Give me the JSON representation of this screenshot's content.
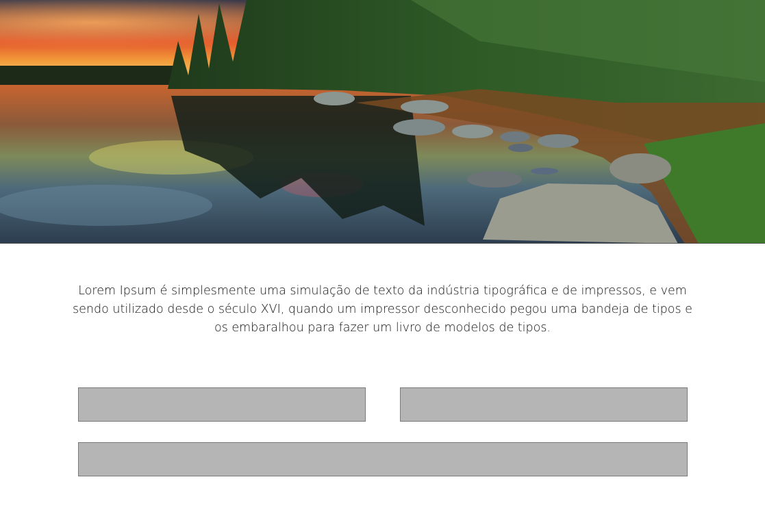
{
  "hero": {
    "image": "lake-forest-sunset-landscape"
  },
  "intro": {
    "text": "Lorem Ipsum é simplesmente uma simulação de texto da indústria tipográfica e de impressos, e vem sendo utilizado desde o século XVI, quando um impressor desconhecido pegou uma bandeja de tipos e os embaralhou para fazer um livro de modelos de tipos."
  },
  "fields": [
    {
      "value": ""
    },
    {
      "value": ""
    },
    {
      "value": ""
    }
  ],
  "colors": {
    "field_fill": "#b5b5b5",
    "field_border": "#7a7a7a",
    "text": "#111111",
    "background": "#ffffff"
  }
}
